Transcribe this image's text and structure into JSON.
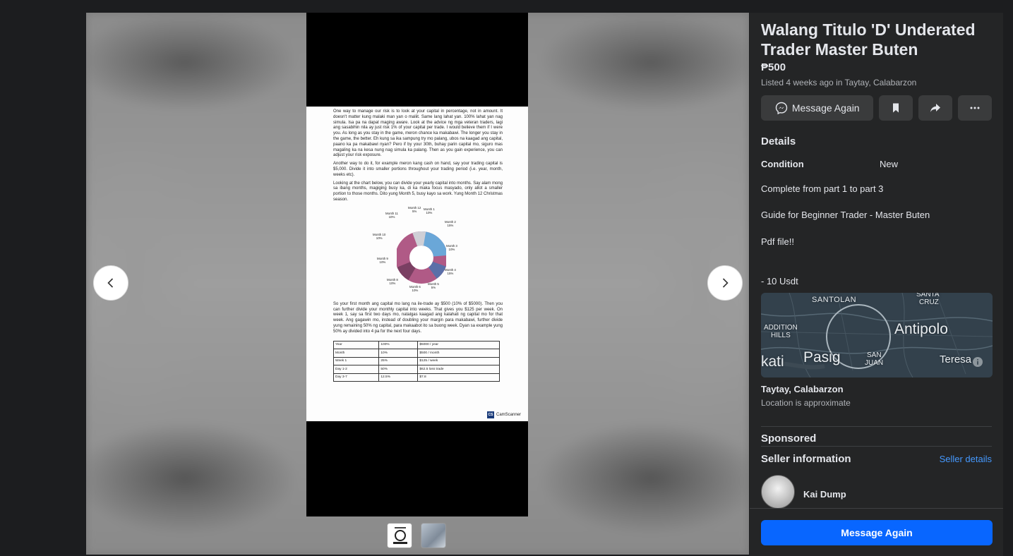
{
  "viewer": {
    "prev_icon": "chevron-left-icon",
    "next_icon": "chevron-right-icon",
    "photo": {
      "paragraph1": "One way to manage our risk is to look at your capital in percentage, not in amount. It doesn't matter kung malaki man yan o maliit. Same lang lahat yan. 100% lahat yan nag simula. Isa pa na dapat maging aware. Look at the advice ng mga veteran traders, lagi ang sasabihin nila ay just risk 1% of your capital per trade. I would believe them if I were you. As long as you stay in the game, meron chance ka makabawi. The longer you stay in the game, the better. Eh kung sa ika sampung try mo palang, ubos na kaagad ang capital, paano ka pa makabawi nyan? Pero if by your 30th, buhay parin capital mo, siguro mas magaling ka na kesa nung nag simula ka palang. Then as you gain experience, you can adjust your risk exposure.",
      "paragraph2": "Another way to do it, for example meron kang cash on hand, say your trading capital is $5,000. Divide it into smaller portions throughout your trading period (i.e. year, month, weeks etc).",
      "paragraph3": "Looking at the chart below, you can divide your yearly capital into months. Say alam mong sa ibang months, magiging busy ka, di ka maka focus masyado, only allot a smaller portion to those months. Dito yung Month 5, busy kayo sa work. Yung Month 12 Christmas season.",
      "donut_labels": [
        {
          "name": "Month 1",
          "pct": "10%"
        },
        {
          "name": "Month 2",
          "pct": "15%"
        },
        {
          "name": "Month 3",
          "pct": "10%"
        },
        {
          "name": "Month 4",
          "pct": "15%"
        },
        {
          "name": "Month 5",
          "pct": "5%"
        },
        {
          "name": "Month 6",
          "pct": "10%"
        },
        {
          "name": "Month 8",
          "pct": "10%"
        },
        {
          "name": "Month 9",
          "pct": "10%"
        },
        {
          "name": "Month 10",
          "pct": "10%"
        },
        {
          "name": "Month 11",
          "pct": "10%"
        },
        {
          "name": "Month 12",
          "pct": "5%"
        }
      ],
      "paragraph4": "So your first month ang capital mo lang na ile-trade ay $500 (10% of $5000). Then you can further divide your monthly capital into weeks. That gives you $125 per week. On week 1, say sa first two days mo, natalgas kaagad ang kalahati ng capital mo for that week. Ang gagawin mo, instead of doubling your margin para makabawi, further divide yung remaining 50% ng capital, para makaabot ito sa buong week. Dyan sa example yung 50% ay divided into 4 pa for the next four days.",
      "table": [
        [
          "Year",
          "100%",
          "$5000 / year"
        ],
        [
          "Month",
          "10%",
          "$500 / month"
        ],
        [
          "Week 1",
          "25%",
          "$125 / week"
        ],
        [
          "Day 1-2",
          "50%",
          "$62.5 loss trade"
        ],
        [
          "Day 3-7",
          "12.5%",
          "$7.8"
        ]
      ],
      "cs_mark": "CS",
      "scanner_label": "CamScanner"
    }
  },
  "listing": {
    "title": "Walang Titulo 'D' Underated Trader Master Buten",
    "price": "₱500",
    "listed": "Listed 4 weeks ago in Taytay, Calabarzon",
    "message_button": "Message Again",
    "details_heading": "Details",
    "condition_label": "Condition",
    "condition_value": "New",
    "description_lines": [
      "Complete from part 1 to part 3",
      "Guide for Beginner Trader - Master Buten",
      "Pdf file!!",
      "- 10 Usdt"
    ],
    "map_labels": {
      "santolan": "SANTOLAN",
      "santa_cruz_1": "SANTA",
      "santa_cruz_2": "CRUZ",
      "addition_1": "ADDITION",
      "addition_2": "HILLS",
      "antipolo": "Antipolo",
      "kati": "kati",
      "pasig": "Pasig",
      "san_juan_1": "SAN",
      "san_juan_2": "JUAN",
      "teresa": "Teresa"
    },
    "location_title": "Taytay, Calabarzon",
    "location_sub": "Location is approximate",
    "sponsored": "Sponsored",
    "seller_heading": "Seller information",
    "seller_details": "Seller details",
    "seller_name": "Kai Dump",
    "bottom_button": "Message Again"
  },
  "colors": {
    "panel_bg": "#242526",
    "primary_blue": "#0866ff",
    "link_blue": "#4599ff",
    "text_primary": "#e4e6eb",
    "text_secondary": "#b0b3b8"
  }
}
